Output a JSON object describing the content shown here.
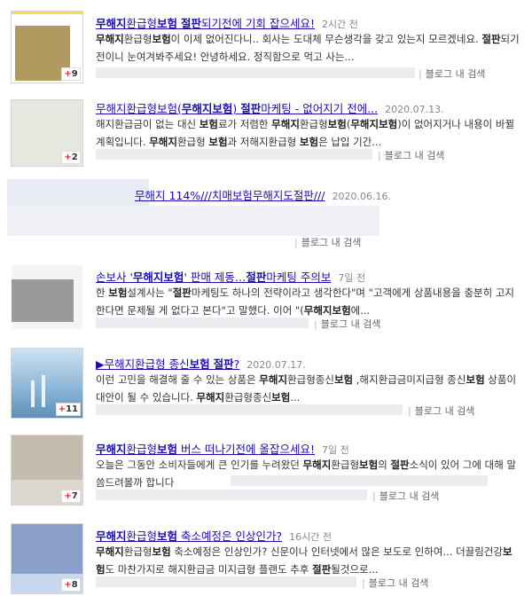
{
  "results": [
    {
      "title_parts": [
        [
          "무해지",
          true
        ],
        [
          "환급형",
          false
        ],
        [
          "보험",
          true
        ],
        [
          " ",
          false
        ],
        [
          "절판",
          true
        ],
        [
          "되기전에 기회 잡으세요!",
          false
        ]
      ],
      "date": "2시간 전",
      "snippet_parts": [
        [
          "무해지",
          true
        ],
        [
          "환급형",
          false
        ],
        [
          "보험",
          true
        ],
        [
          "이 이제 없어진다니.. 회사는 도대체 무슨생각을 갖고 있는지 모르겠네요. ",
          false
        ],
        [
          "절판",
          true
        ],
        [
          "되기전이니 눈여겨봐주세요! 안녕하세요. 정직함으로 먹고 사는...",
          false
        ]
      ],
      "badge": "9",
      "blog_label": "블로그 내 검색",
      "thumb_color": "#b09a60"
    },
    {
      "title_parts": [
        [
          "무해지환급형보험(",
          false
        ],
        [
          "무해지보험",
          true
        ],
        [
          ") ",
          false
        ],
        [
          "절판",
          true
        ],
        [
          "마케팅 - 없어지기 전에...",
          false
        ]
      ],
      "date": "2020.07.13.",
      "snippet_parts": [
        [
          "해지환급금이 없는 대신 ",
          false
        ],
        [
          "보험",
          true
        ],
        [
          "료가 저렴한 ",
          false
        ],
        [
          "무해지",
          true
        ],
        [
          "환급형",
          false
        ],
        [
          "보험",
          true
        ],
        [
          "(",
          false
        ],
        [
          "무해지보험",
          true
        ],
        [
          ")이 없어지거나 내용이 바뀔 계획입니다. ",
          false
        ],
        [
          "무해지",
          true
        ],
        [
          "환급형 ",
          false
        ],
        [
          "보험",
          true
        ],
        [
          "과 저해지환급형 ",
          false
        ],
        [
          "보험",
          true
        ],
        [
          "은 납입 기간...",
          false
        ]
      ],
      "badge": "2",
      "blog_label": "블로그 내 검색",
      "thumb_color": "#e6e8df"
    },
    {
      "title_parts": [
        [
          "무해지 114%///치매보험무해지도절판///",
          false
        ]
      ],
      "date": "2020.06.16.",
      "snippet_parts": [],
      "badge": "",
      "blog_label": "블로그 내 검색",
      "thumb_color": "#eef0f5"
    },
    {
      "title_parts": [
        [
          "손보사 '",
          false
        ],
        [
          "무해지보험",
          true
        ],
        [
          "' 판매 제동…",
          false
        ],
        [
          "절판",
          true
        ],
        [
          "마케팅 주의보",
          false
        ]
      ],
      "date": "7일 전",
      "snippet_parts": [
        [
          "한 ",
          false
        ],
        [
          "보험",
          true
        ],
        [
          "설계사는 \"",
          false
        ],
        [
          "절판",
          true
        ],
        [
          "마케팅도 하나의 전략이라고 생각한다\"며 \"고객에게 상품내용을 충분히 고지한다면 문제될 게 없다고 본다\"고 말했다. 이어 \"(",
          false
        ],
        [
          "무해지보험",
          true
        ],
        [
          "에...",
          false
        ]
      ],
      "badge": "",
      "blog_label": "블로그 내 검색",
      "thumb_color": "#9a9a9a"
    },
    {
      "title_parts": [
        [
          "▶무해지환급형 종신",
          false
        ],
        [
          "보험",
          true
        ],
        [
          " ",
          false
        ],
        [
          "절판",
          true
        ],
        [
          "?",
          false
        ]
      ],
      "date": "2020.07.17.",
      "snippet_parts": [
        [
          "이런 고민을 해결해 줄 수 있는 상품은 ",
          false
        ],
        [
          "무해지",
          true
        ],
        [
          "환급형종신",
          false
        ],
        [
          "보험",
          true
        ],
        [
          " ,해지환급금미지급형 종신",
          false
        ],
        [
          "보험",
          true
        ],
        [
          " 상품이 대안이 될 수 있습니다. ",
          false
        ],
        [
          "무해지",
          true
        ],
        [
          "환급형종신",
          false
        ],
        [
          "보험",
          true
        ],
        [
          "...",
          false
        ]
      ],
      "badge": "11",
      "blog_label": "블로그 내 검색",
      "thumb_color": "#8fb8d8"
    },
    {
      "title_parts": [
        [
          "무해지",
          true
        ],
        [
          "환급형",
          false
        ],
        [
          "보험",
          true
        ],
        [
          " 버스 떠나기전에 올잡으세요!",
          false
        ]
      ],
      "date": "7일 전",
      "snippet_parts": [
        [
          "오늘은 그동안 소비자들에게 큰 인기를 누려왔던 ",
          false
        ],
        [
          "무해지",
          true
        ],
        [
          "환급형",
          false
        ],
        [
          "보험",
          true
        ],
        [
          "의 ",
          false
        ],
        [
          "절판",
          true
        ],
        [
          "소식이 있어 그에 대해 말씀드려볼까 합니다",
          false
        ]
      ],
      "badge": "7",
      "blog_label": "블로그 내 검색",
      "thumb_color": "#c4bcae"
    },
    {
      "title_parts": [
        [
          "무해지",
          true
        ],
        [
          "환급형",
          false
        ],
        [
          "보험",
          true
        ],
        [
          " 축소예정은 인상인가?",
          false
        ]
      ],
      "date": "16시간 전",
      "snippet_parts": [
        [
          "무해지",
          true
        ],
        [
          "환급형",
          false
        ],
        [
          "보험",
          true
        ],
        [
          " 축소예정은 인상인가? 신문이나 인터넷에서 많은 보도로 인하여... 더끌림건강",
          false
        ],
        [
          "보험",
          true
        ],
        [
          "도 마찬가지로 해지환급금 미지급형 플랜도 추후 ",
          false
        ],
        [
          "절판",
          true
        ],
        [
          "될것으로...",
          false
        ]
      ],
      "badge": "8",
      "blog_label": "블로그 내 검색",
      "thumb_color": "#8aa0c8"
    }
  ]
}
